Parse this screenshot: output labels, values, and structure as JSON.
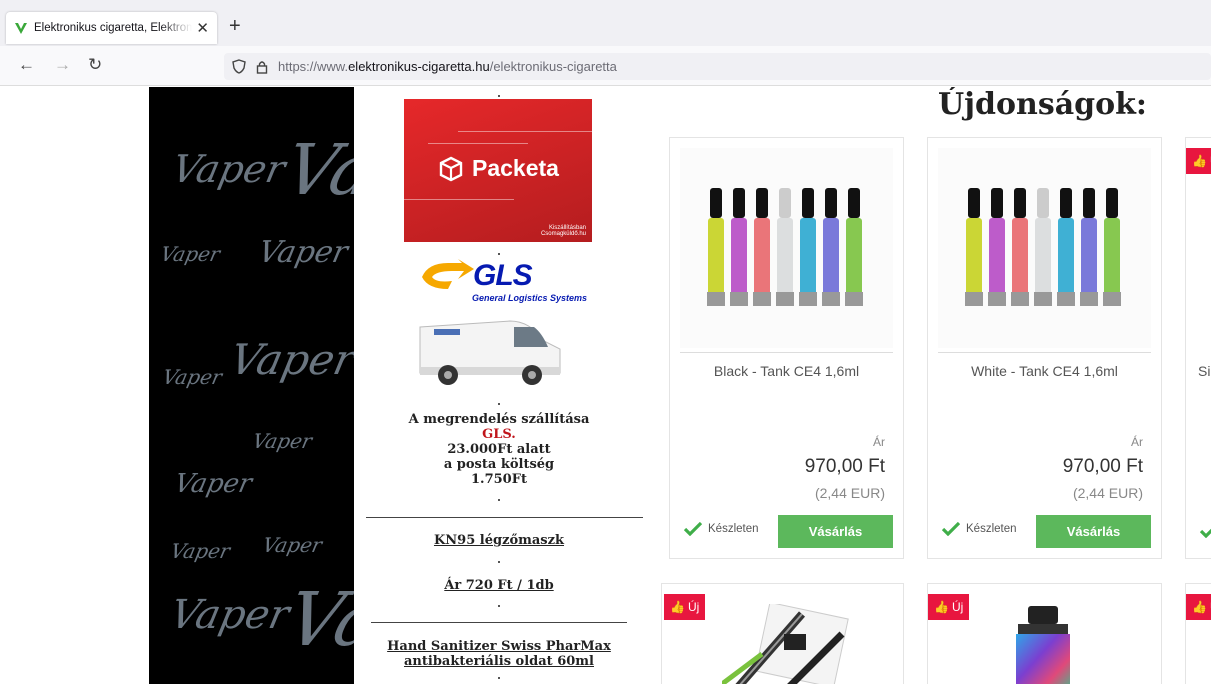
{
  "browser": {
    "tab_title": "Elektronikus cigaretta, Elektromos cigaretta",
    "url_prefix": "https://www.",
    "url_host": "elektronikus-cigaretta.hu",
    "url_path": "/elektronikus-cigaretta"
  },
  "sidebar_banner": {
    "packeta": {
      "brand": "Packeta",
      "sub": "Kiszállításban",
      "sub2": "Csomagküldő.hu"
    },
    "gls": {
      "brand": "GLS",
      "sub": "General Logistics Systems"
    },
    "shipping": {
      "line1": "A megrendelés szállítása",
      "carrier": "GLS.",
      "line2": "23.000Ft alatt",
      "line3": "a posta költség",
      "line4": "1.750Ft"
    },
    "mask_link": "KN95 légzőmaszk",
    "mask_price": "Ár 720 Ft / 1db",
    "sanitizer_line1": "Hand Sanitizer Swiss PharMax",
    "sanitizer_line2": "antibakteriális oldat 60ml"
  },
  "vaper_word": "Vaper",
  "new_products": {
    "title": "Újdonságok:",
    "badge_label": "Új",
    "items": [
      {
        "name": "Black - Tank CE4 1,6ml",
        "price_label": "Ár",
        "price": "970,00 Ft",
        "eur": "(2,44 EUR)",
        "stock": "Készleten",
        "buy": "Vásárlás"
      },
      {
        "name": "White - Tank CE4 1,6ml",
        "price_label": "Ár",
        "price": "970,00 Ft",
        "eur": "(2,44 EUR)",
        "stock": "Készleten",
        "buy": "Vásárlás"
      },
      {
        "name": "Si"
      }
    ]
  },
  "colors": {
    "badge": "#e8163f",
    "buy_button": "#5cb85c",
    "stock_check": "#3fae49"
  }
}
